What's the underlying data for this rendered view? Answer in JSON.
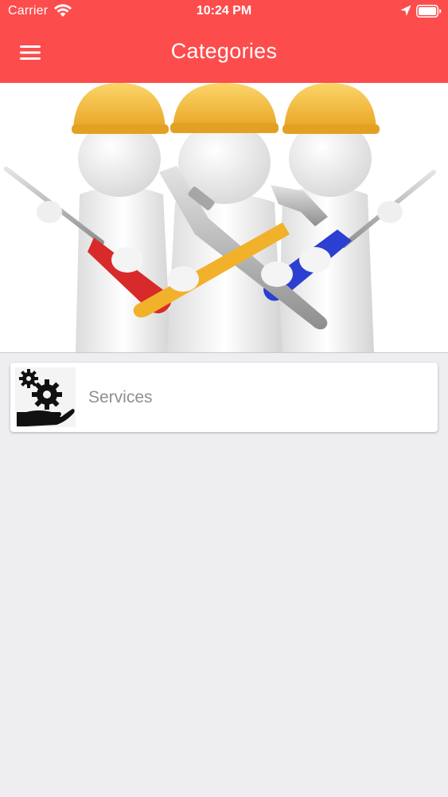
{
  "status_bar": {
    "carrier": "Carrier",
    "time": "10:24 PM",
    "icons": [
      "wifi-icon",
      "location-arrow-icon",
      "battery-icon"
    ]
  },
  "nav": {
    "title": "Categories",
    "menu_icon": "hamburger-menu-icon"
  },
  "banner": {
    "image": "three workers with hard hats holding screwdrivers, wrench and hammer"
  },
  "categories": [
    {
      "label": "Services",
      "icon": "gears-in-hand-icon"
    }
  ],
  "colors": {
    "header": "#fd4c4c",
    "background": "#eeeef0",
    "card": "#ffffff",
    "card_text": "#8e8e93"
  }
}
